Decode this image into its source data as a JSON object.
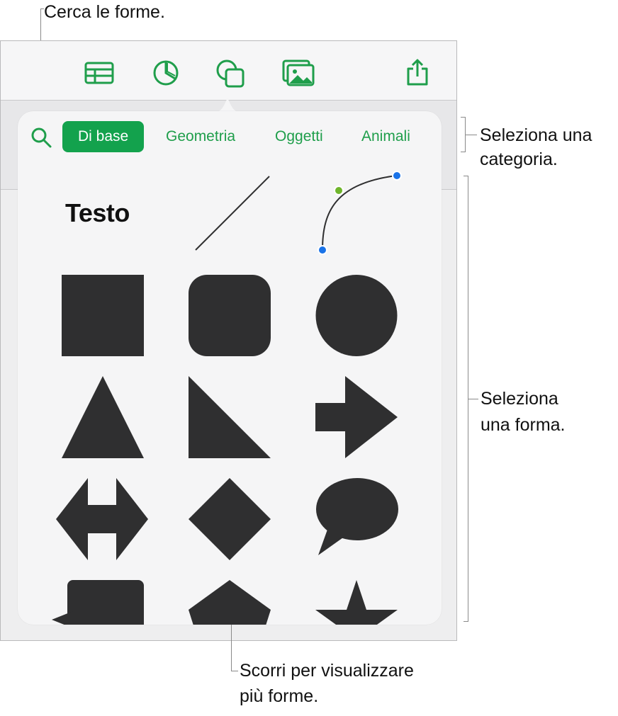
{
  "callouts": {
    "search": "Cerca le forme.",
    "category_line1": "Seleziona una",
    "category_line2": "categoria.",
    "shape_line1": "Seleziona",
    "shape_line2": "una forma.",
    "scroll_line1": "Scorri per visualizzare",
    "scroll_line2": "più forme."
  },
  "toolbar": {
    "items": [
      "table-icon",
      "chart-icon",
      "shapes-icon",
      "media-icon",
      "share-icon"
    ],
    "accent": "#1f9e4b"
  },
  "shapes_panel": {
    "tabs": [
      {
        "label": "Di base",
        "active": true
      },
      {
        "label": "Geometria",
        "active": false
      },
      {
        "label": "Oggetti",
        "active": false
      },
      {
        "label": "Animali",
        "active": false
      }
    ],
    "text_shape_label": "Testo",
    "shape_color": "#2f2f30",
    "active_tab_color": "#13a24d",
    "curve_handle_colors": [
      "#1a73e8",
      "#6fb52c"
    ],
    "shape_names": [
      "text",
      "line",
      "curve",
      "square",
      "rounded-square",
      "circle",
      "triangle",
      "right-triangle",
      "arrow",
      "double-arrow",
      "diamond",
      "speech-bubble",
      "callout-rectangle",
      "pentagon",
      "star"
    ]
  }
}
